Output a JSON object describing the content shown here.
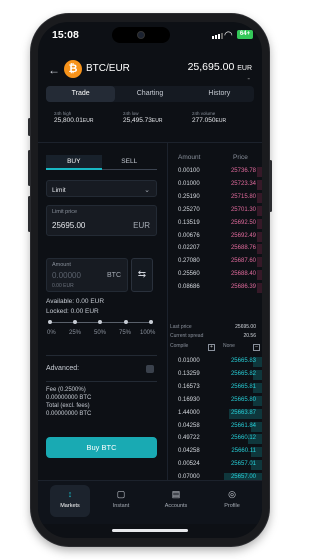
{
  "status_bar": {
    "time": "15:08",
    "battery": "64+"
  },
  "header": {
    "pair": "BTC/EUR",
    "price": "25,695.00",
    "price_unit": "EUR",
    "price_change": "-"
  },
  "tabs": [
    "Trade",
    "Charting",
    "History"
  ],
  "stats": [
    {
      "label": "24h high",
      "value": "25,800.01",
      "unit": "EUR"
    },
    {
      "label": "24h low",
      "value": "25,495.73",
      "unit": "EUR"
    },
    {
      "label": "24h volume",
      "value": "277.050",
      "unit": "EUR"
    }
  ],
  "order_form": {
    "buy_label": "BUY",
    "sell_label": "SELL",
    "order_type": "Limit",
    "limit_price_label": "Limit price",
    "limit_price_value": "25695.00",
    "limit_price_unit": "EUR",
    "amount_label": "Amount",
    "amount_placeholder": "0.00000",
    "amount_sub": "0.00 EUR",
    "amount_unit": "BTC",
    "available": "Available: 0.00 EUR",
    "locked": "Locked: 0.00 EUR",
    "slider_labels": [
      "0%",
      "25%",
      "50%",
      "75%",
      "100%"
    ],
    "slider_value_percent": 0,
    "advanced_label": "Advanced:",
    "fee_line": "Fee (0.2500%)",
    "fee_value": "0.00000000 BTC",
    "total_label": "Total (excl. fees)",
    "total_value": "0.00000000 BTC",
    "submit_label": "Buy BTC"
  },
  "order_book": {
    "amount_header": "Amount",
    "price_header": "Price",
    "asks": [
      {
        "amount": "0.00100",
        "price": "25736.78",
        "depth": 0.05
      },
      {
        "amount": "0.01000",
        "price": "25723.34",
        "depth": 0.05
      },
      {
        "amount": "0.25190",
        "price": "25715.80",
        "depth": 0.05
      },
      {
        "amount": "0.25270",
        "price": "25701.30",
        "depth": 0.05
      },
      {
        "amount": "0.13519",
        "price": "25692.50",
        "depth": 0.05
      },
      {
        "amount": "0.00676",
        "price": "25692.49",
        "depth": 0.05
      },
      {
        "amount": "0.02207",
        "price": "25688.76",
        "depth": 0.05
      },
      {
        "amount": "0.27080",
        "price": "25687.60",
        "depth": 0.05
      },
      {
        "amount": "0.25560",
        "price": "25688.40",
        "depth": 0.05
      },
      {
        "amount": "0.08686",
        "price": "25686.39",
        "depth": 0.05
      }
    ],
    "last_price_label": "Last price",
    "last_price_value": "25695.00",
    "spread_label": "Current spread",
    "spread_value": "20.56",
    "compile_label": "Compile",
    "none_label": "None",
    "bids": [
      {
        "amount": "0.01000",
        "price": "25665.83",
        "depth": 0.1
      },
      {
        "amount": "0.13259",
        "price": "25665.82",
        "depth": 0.1
      },
      {
        "amount": "0.16573",
        "price": "25665.81",
        "depth": 0.1
      },
      {
        "amount": "0.16930",
        "price": "25665.80",
        "depth": 0.1
      },
      {
        "amount": "1.44000",
        "price": "25663.87",
        "depth": 0.35
      },
      {
        "amount": "0.04258",
        "price": "25661.84",
        "depth": 0.12
      },
      {
        "amount": "0.49722",
        "price": "25660.12",
        "depth": 0.15
      },
      {
        "amount": "0.04258",
        "price": "25660.11",
        "depth": 0.12
      },
      {
        "amount": "0.00524",
        "price": "25657.01",
        "depth": 0.12
      },
      {
        "amount": "0.07000",
        "price": "25657.00",
        "depth": 0.4
      }
    ]
  },
  "nav": [
    {
      "label": "Markets",
      "icon": "markets-icon"
    },
    {
      "label": "Instant",
      "icon": "instant-icon"
    },
    {
      "label": "Accounts",
      "icon": "accounts-icon"
    },
    {
      "label": "Profile",
      "icon": "profile-icon"
    }
  ],
  "colors": {
    "accent": "#19aab3",
    "ask": "#e36b9e",
    "bid": "#26d0d9",
    "bitcoin": "#f7931a"
  }
}
